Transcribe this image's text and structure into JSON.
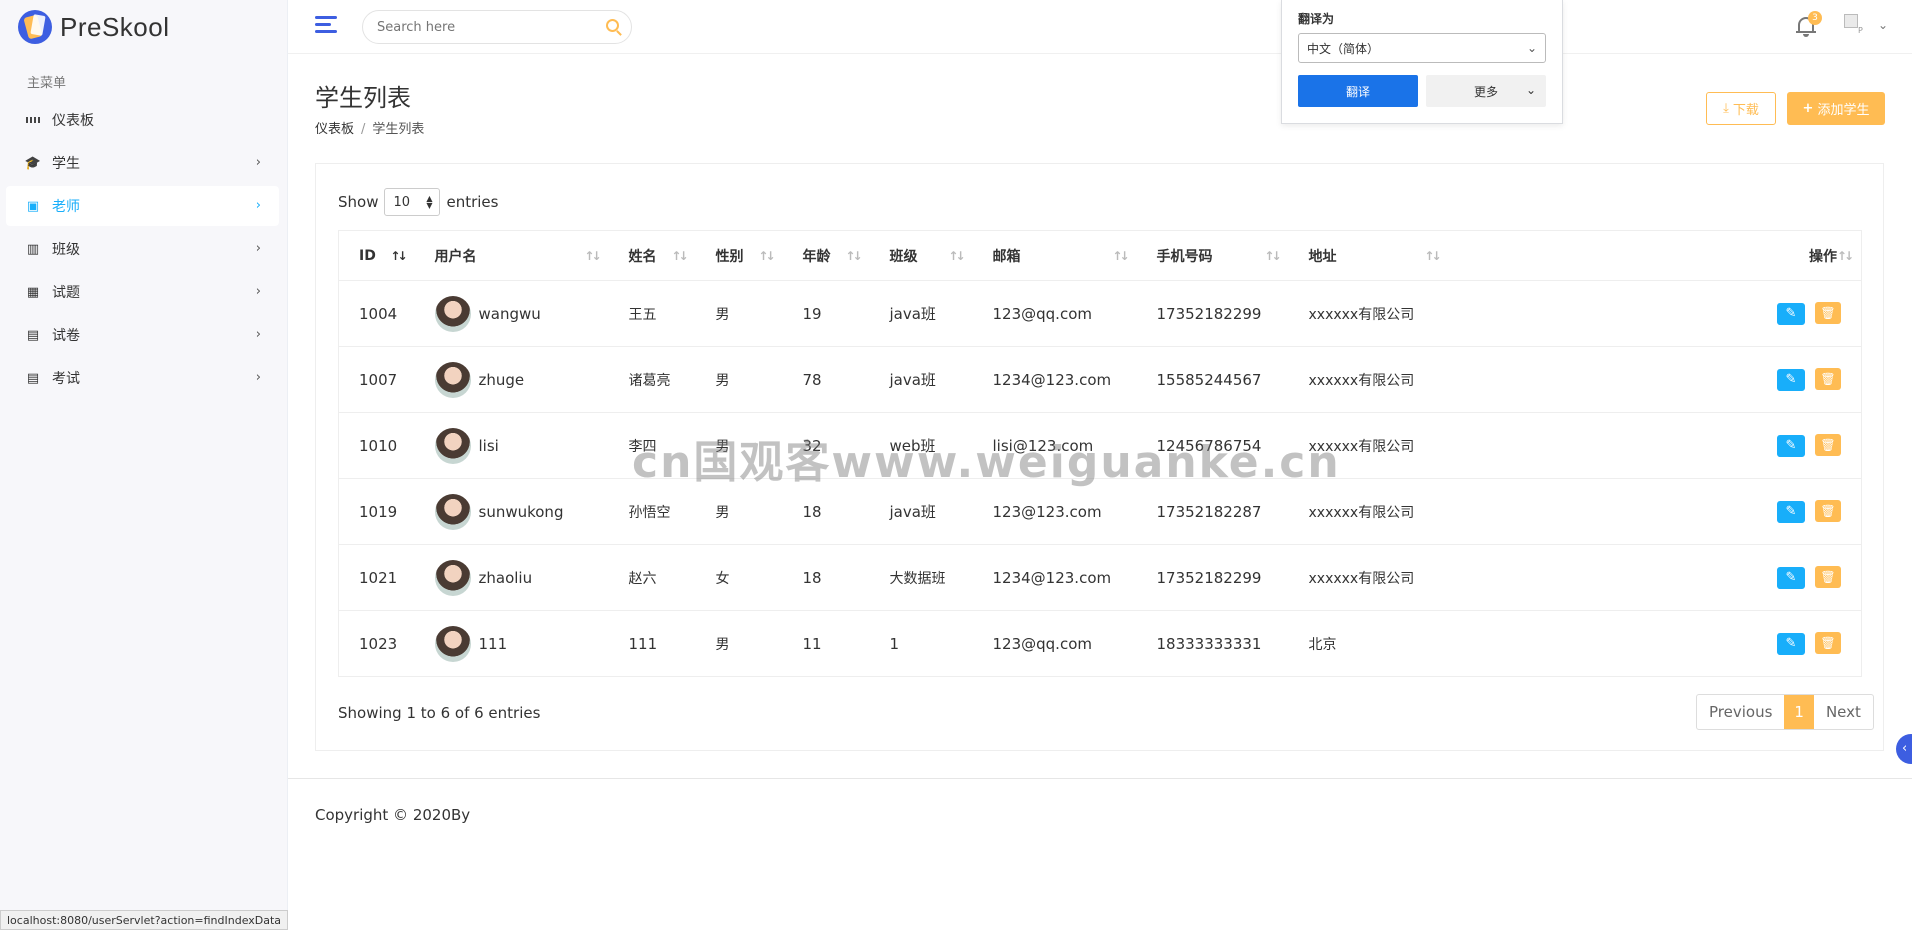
{
  "app": {
    "name": "PreSkool"
  },
  "sidebar": {
    "menu_title": "主菜单",
    "items": [
      {
        "label": "仪表板",
        "icon": "dashboard-icon"
      },
      {
        "label": "学生",
        "icon": "student-icon"
      },
      {
        "label": "老师",
        "icon": "teacher-icon",
        "active": true
      },
      {
        "label": "班级",
        "icon": "building-icon"
      },
      {
        "label": "试题",
        "icon": "book-icon"
      },
      {
        "label": "试卷",
        "icon": "file-icon"
      },
      {
        "label": "考试",
        "icon": "clipboard-icon"
      }
    ]
  },
  "header": {
    "search_placeholder": "Search here",
    "notification_count": "3",
    "avatar_alt": "P"
  },
  "translate": {
    "title": "翻译为",
    "language": "中文（简体）",
    "translate_button": "翻译",
    "more_button": "更多"
  },
  "page": {
    "title": "学生列表",
    "breadcrumb": [
      "仪表板",
      "学生列表"
    ],
    "download_button": "下载",
    "add_button": "添加学生"
  },
  "table": {
    "show_label": "Show",
    "page_length": "10",
    "entries_label": "entries",
    "columns": [
      "ID",
      "用户名",
      "姓名",
      "性别",
      "年龄",
      "班级",
      "邮箱",
      "手机号码",
      "地址",
      "操作"
    ],
    "rows": [
      {
        "id": "1004",
        "username": "wangwu",
        "name": "王五",
        "gender": "男",
        "age": "19",
        "class": "java班",
        "email": "123@qq.com",
        "phone": "17352182299",
        "address": "xxxxxx有限公司"
      },
      {
        "id": "1007",
        "username": "zhuge",
        "name": "诸葛亮",
        "gender": "男",
        "age": "78",
        "class": "java班",
        "email": "1234@123.com",
        "phone": "15585244567",
        "address": "xxxxxx有限公司"
      },
      {
        "id": "1010",
        "username": "lisi",
        "name": "李四",
        "gender": "男",
        "age": "32",
        "class": "web班",
        "email": "lisi@123.com",
        "phone": "12456786754",
        "address": "xxxxxx有限公司"
      },
      {
        "id": "1019",
        "username": "sunwukong",
        "name": "孙悟空",
        "gender": "男",
        "age": "18",
        "class": "java班",
        "email": "123@123.com",
        "phone": "17352182287",
        "address": "xxxxxx有限公司"
      },
      {
        "id": "1021",
        "username": "zhaoliu",
        "name": "赵六",
        "gender": "女",
        "age": "18",
        "class": "大数据班",
        "email": "1234@123.com",
        "phone": "17352182299",
        "address": "xxxxxx有限公司"
      },
      {
        "id": "1023",
        "username": "111",
        "name": "111",
        "gender": "男",
        "age": "11",
        "class": "1",
        "email": "123@qq.com",
        "phone": "18333333331",
        "address": "北京"
      }
    ],
    "info": "Showing 1 to 6 of 6 entries",
    "pagination": {
      "previous": "Previous",
      "current": "1",
      "next": "Next"
    }
  },
  "footer": {
    "copyright": "Copyright © 2020By"
  },
  "status_bar": {
    "url": "localhost:8080/userServlet?action=findIndexData"
  },
  "watermark": "cn国观客www.weiguanke.cn",
  "colors": {
    "primary": "#3d5ee1",
    "accent": "#ffbc53",
    "info": "#18aefa"
  }
}
